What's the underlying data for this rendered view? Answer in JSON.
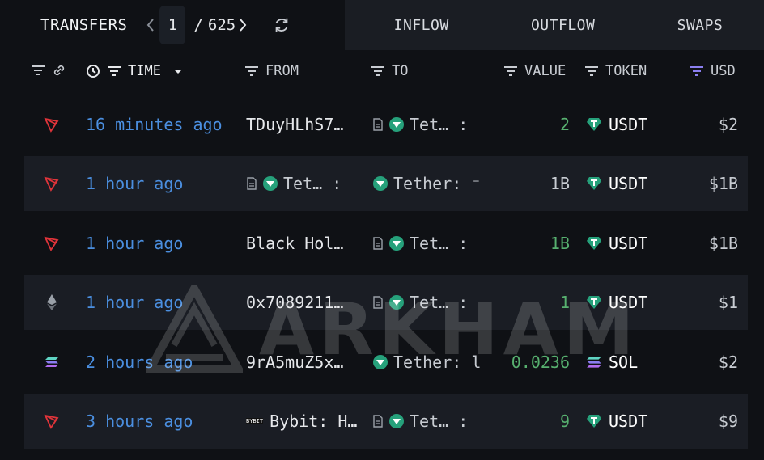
{
  "header": {
    "title": "TRANSFERS",
    "page_current": "1",
    "page_sep": "/",
    "page_total": "625"
  },
  "tabs": [
    {
      "label": "INFLOW"
    },
    {
      "label": "OUTFLOW"
    },
    {
      "label": "SWAPS"
    }
  ],
  "columns": {
    "time": "TIME",
    "from": "FROM",
    "to": "TO",
    "value": "VALUE",
    "token": "TOKEN",
    "usd": "USD"
  },
  "rows": [
    {
      "chain": "tron",
      "time": "16 minutes ago",
      "from": "TDuyHLhS7…",
      "to": "Tet… :",
      "value": "2",
      "token": "USDT",
      "usd": "$2"
    },
    {
      "chain": "tron",
      "time": "1 hour ago",
      "from": "Tet… :",
      "to": "Tether: ⁻",
      "value": "1B",
      "token": "USDT",
      "usd": "$1B"
    },
    {
      "chain": "tron",
      "time": "1 hour ago",
      "from": "Black Hol…",
      "to": "Tet… :",
      "value": "1B",
      "token": "USDT",
      "usd": "$1B"
    },
    {
      "chain": "ethereum",
      "time": "1 hour ago",
      "from": "0x7089211…",
      "to": "Tet… :",
      "value": "1",
      "token": "USDT",
      "usd": "$1"
    },
    {
      "chain": "solana",
      "time": "2 hours ago",
      "from": "9rA5muZ5x…",
      "to": "Tether: l",
      "value": "0.0236",
      "token": "SOL",
      "usd": "$2"
    },
    {
      "chain": "tron",
      "time": "3 hours ago",
      "from": "Bybit: H…",
      "to": "Tet… :",
      "value": "9",
      "token": "USDT",
      "usd": "$9"
    }
  ],
  "bybit_logo_text": "BYBIT",
  "watermark": "ARKHAM",
  "colors": {
    "background": "#0f1115",
    "row_alt": "#1a1d24",
    "time_blue": "#4b8fe0",
    "value_green": "#57b06f",
    "tether": "#26a17b",
    "tron_red": "#e0343a",
    "usd_sort_purple": "#8b7ff0"
  }
}
